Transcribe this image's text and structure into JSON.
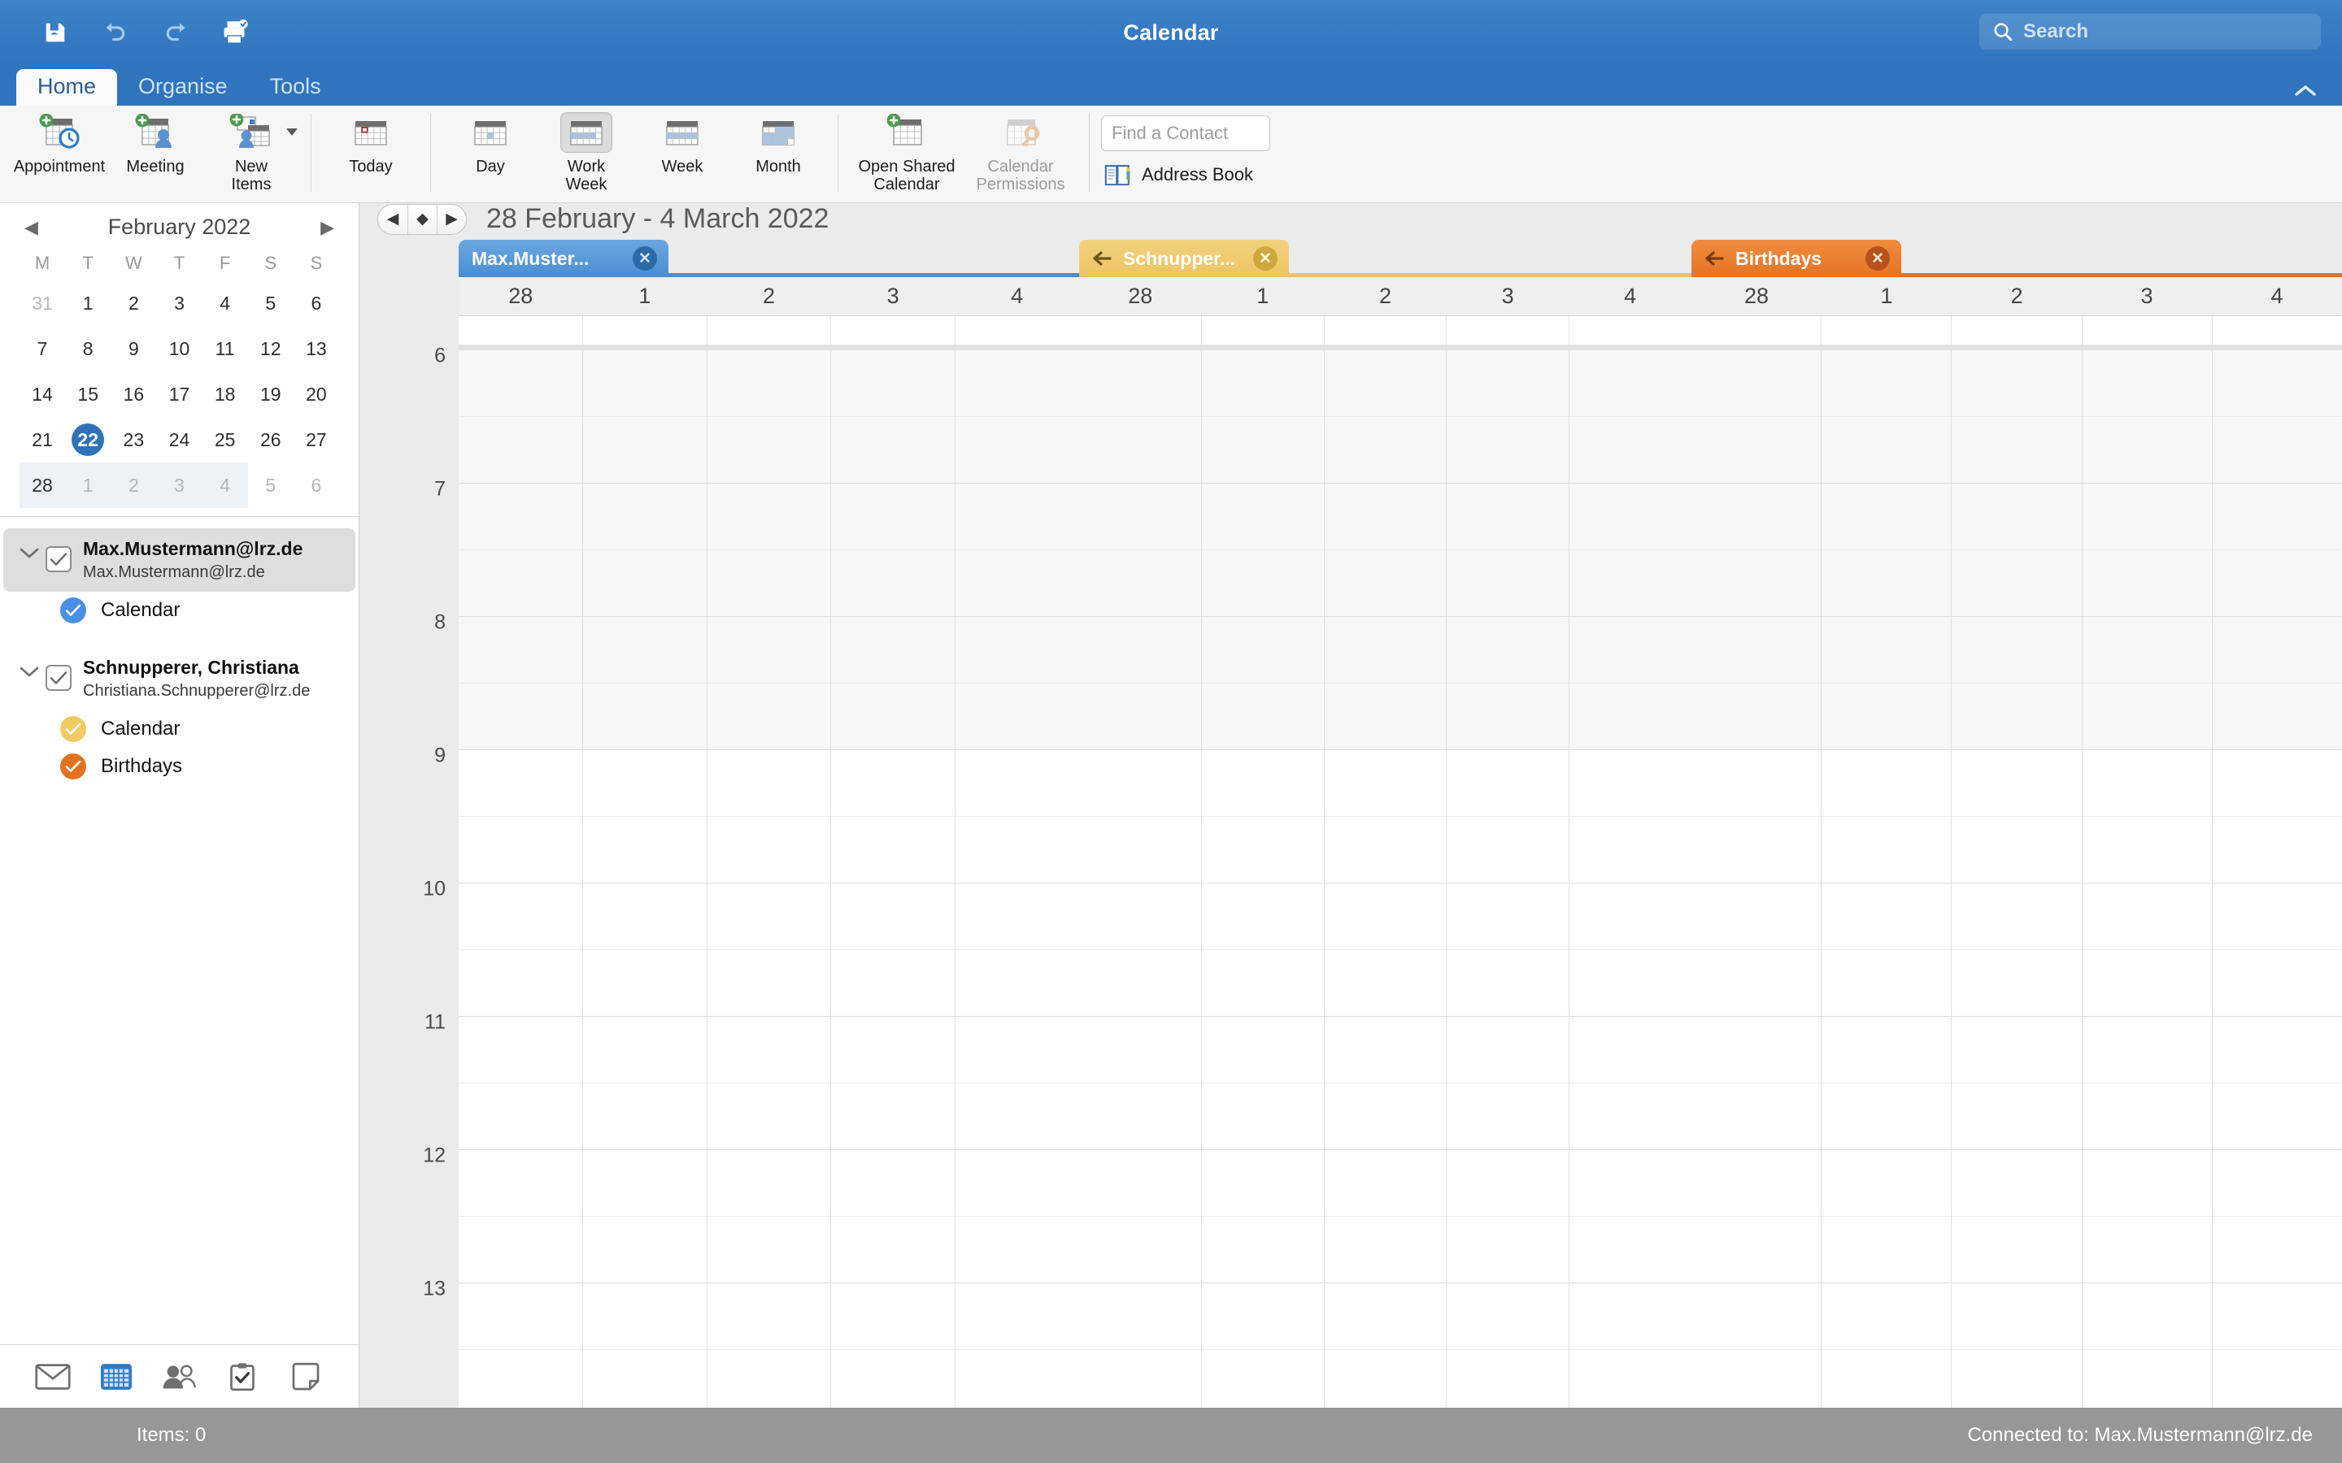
{
  "window": {
    "title": "Calendar",
    "quick_access": [
      {
        "name": "save-icon",
        "label": "Save"
      },
      {
        "name": "undo-icon",
        "label": "Undo"
      },
      {
        "name": "redo-icon",
        "label": "Redo"
      },
      {
        "name": "print-icon",
        "label": "Print"
      }
    ],
    "search": {
      "placeholder": "Search",
      "icon": "search-icon"
    },
    "collapse_icon": "chevron-up-icon"
  },
  "ribbon": {
    "tabs": [
      {
        "label": "Home",
        "active": true
      },
      {
        "label": "Organise",
        "active": false
      },
      {
        "label": "Tools",
        "active": false
      }
    ],
    "groups": [
      {
        "items": [
          {
            "label": "Appointment",
            "icon": "new-appointment-icon",
            "state": "enabled"
          },
          {
            "label": "Meeting",
            "icon": "new-meeting-icon",
            "state": "enabled"
          },
          {
            "label": "New\nItems",
            "label_line1": "New",
            "label_line2": "Items",
            "icon": "new-items-icon",
            "state": "enabled",
            "has_dropdown": true
          }
        ]
      },
      {
        "items": [
          {
            "label": "Today",
            "icon": "today-icon",
            "state": "enabled"
          }
        ]
      },
      {
        "items": [
          {
            "label": "Day",
            "icon": "day-view-icon",
            "state": "enabled"
          },
          {
            "label_line1": "Work",
            "label_line2": "Week",
            "label": "Work Week",
            "icon": "work-week-view-icon",
            "state": "selected"
          },
          {
            "label": "Week",
            "icon": "week-view-icon",
            "state": "enabled"
          },
          {
            "label": "Month",
            "icon": "month-view-icon",
            "state": "enabled"
          }
        ]
      },
      {
        "items": [
          {
            "label_line1": "Open Shared",
            "label_line2": "Calendar",
            "label": "Open Shared Calendar",
            "icon": "open-shared-calendar-icon",
            "state": "enabled"
          },
          {
            "label_line1": "Calendar",
            "label_line2": "Permissions",
            "label": "Calendar Permissions",
            "icon": "calendar-permissions-icon",
            "state": "disabled"
          }
        ]
      }
    ],
    "find_contact": {
      "placeholder": "Find a Contact",
      "value": ""
    },
    "address_book": {
      "label": "Address Book",
      "icon": "address-book-icon"
    }
  },
  "sidebar": {
    "mini_calendar": {
      "title": "February 2022",
      "prev_icon": "triangle-left-icon",
      "next_icon": "triangle-right-icon",
      "day_initials": [
        "M",
        "T",
        "W",
        "T",
        "F",
        "S",
        "S"
      ],
      "weeks": [
        [
          {
            "d": "31",
            "muted": true
          },
          {
            "d": "1"
          },
          {
            "d": "2"
          },
          {
            "d": "3"
          },
          {
            "d": "4"
          },
          {
            "d": "5"
          },
          {
            "d": "6"
          }
        ],
        [
          {
            "d": "7"
          },
          {
            "d": "8"
          },
          {
            "d": "9"
          },
          {
            "d": "10"
          },
          {
            "d": "11"
          },
          {
            "d": "12"
          },
          {
            "d": "13"
          }
        ],
        [
          {
            "d": "14"
          },
          {
            "d": "15"
          },
          {
            "d": "16"
          },
          {
            "d": "17"
          },
          {
            "d": "18"
          },
          {
            "d": "19"
          },
          {
            "d": "20"
          }
        ],
        [
          {
            "d": "21"
          },
          {
            "d": "22",
            "today": true
          },
          {
            "d": "23"
          },
          {
            "d": "24"
          },
          {
            "d": "25"
          },
          {
            "d": "26"
          },
          {
            "d": "27"
          }
        ],
        [
          {
            "d": "28",
            "selected_week": true
          },
          {
            "d": "1",
            "muted": true,
            "selected_week": true
          },
          {
            "d": "2",
            "muted": true,
            "selected_week": true
          },
          {
            "d": "3",
            "muted": true,
            "selected_week": true
          },
          {
            "d": "4",
            "muted": true,
            "selected_week": true
          },
          {
            "d": "5",
            "muted": true
          },
          {
            "d": "6",
            "muted": true
          }
        ]
      ]
    },
    "accounts": [
      {
        "name": "Max.Mustermann@lrz.de",
        "email": "Max.Mustermann@lrz.de",
        "checked": true,
        "selected": true,
        "expanded": true,
        "calendars": [
          {
            "label": "Calendar",
            "color": "#4a90e2",
            "checked": true
          }
        ]
      },
      {
        "name": "Schnupperer, Christiana",
        "email": "Christiana.Schnupperer@lrz.de",
        "checked": true,
        "selected": false,
        "expanded": true,
        "calendars": [
          {
            "label": "Calendar",
            "color": "#f0cb63",
            "checked": true
          },
          {
            "label": "Birthdays",
            "color": "#e2721f",
            "checked": true
          }
        ]
      }
    ],
    "bottom_nav": [
      {
        "name": "mail-icon",
        "label": "Mail",
        "active": false
      },
      {
        "name": "calendar-icon",
        "label": "Calendar",
        "active": true
      },
      {
        "name": "people-icon",
        "label": "People",
        "active": false
      },
      {
        "name": "tasks-icon",
        "label": "Tasks",
        "active": false
      },
      {
        "name": "notes-icon",
        "label": "Notes",
        "active": false
      }
    ]
  },
  "calendar": {
    "date_range": "28 February - 4 March 2022",
    "nav": {
      "prev": "◀",
      "today": "◆",
      "next": "▶"
    },
    "groups": [
      {
        "tab_label": "Max.Muster...",
        "color": "#4a8ed1",
        "has_back_arrow": false,
        "close_icon": "close-icon",
        "days": [
          "28",
          "1",
          "2",
          "3",
          "4"
        ]
      },
      {
        "tab_label": "Schnupper...",
        "color": "#ecc463",
        "has_back_arrow": true,
        "back_icon": "arrow-left-icon",
        "close_icon": "close-icon",
        "days": [
          "28",
          "1",
          "2",
          "3",
          "4"
        ]
      },
      {
        "tab_label": "Birthdays",
        "color": "#e57325",
        "has_back_arrow": true,
        "back_icon": "arrow-left-icon",
        "close_icon": "close-icon",
        "days": [
          "28",
          "1",
          "2",
          "3",
          "4"
        ]
      }
    ],
    "hours": [
      "6",
      "7",
      "8",
      "9",
      "10",
      "11",
      "12",
      "13"
    ],
    "working_hours_start": "9"
  },
  "status": {
    "items_count": "Items: 0",
    "connection": "Connected to: Max.Mustermann@lrz.de"
  }
}
